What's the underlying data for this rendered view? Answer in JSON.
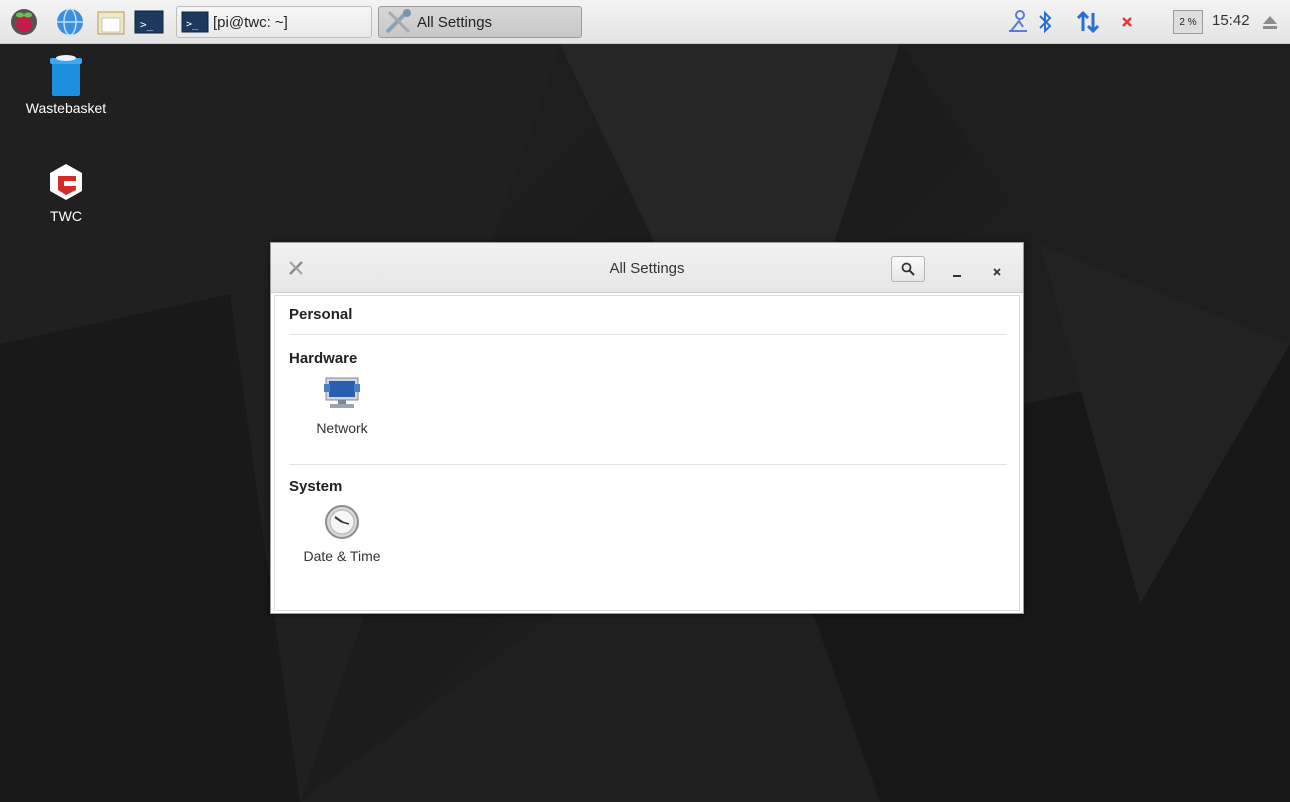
{
  "taskbar": {
    "launchers": [
      {
        "name": "raspberry-menu-icon"
      },
      {
        "name": "web-browser-icon"
      },
      {
        "name": "file-manager-icon"
      },
      {
        "name": "terminal-icon"
      }
    ],
    "tasks": [
      {
        "label": "[pi@twc: ~]",
        "icon": "terminal-icon",
        "active": false
      },
      {
        "label": "All Settings",
        "icon": "settings-tools-icon",
        "active": true
      }
    ],
    "tray": {
      "cpu_label": "2 %",
      "clock": "15:42"
    }
  },
  "desktop": {
    "icons": [
      {
        "label": "Wastebasket",
        "icon": "trash-icon"
      },
      {
        "label": "TWC",
        "icon": "twc-app-icon"
      }
    ]
  },
  "window": {
    "title": "All Settings",
    "sections": [
      {
        "title": "Personal",
        "items": []
      },
      {
        "title": "Hardware",
        "items": [
          {
            "label": "Network",
            "icon": "network-icon"
          }
        ]
      },
      {
        "title": "System",
        "items": [
          {
            "label": "Date & Time",
            "icon": "clock-icon"
          }
        ]
      }
    ]
  }
}
